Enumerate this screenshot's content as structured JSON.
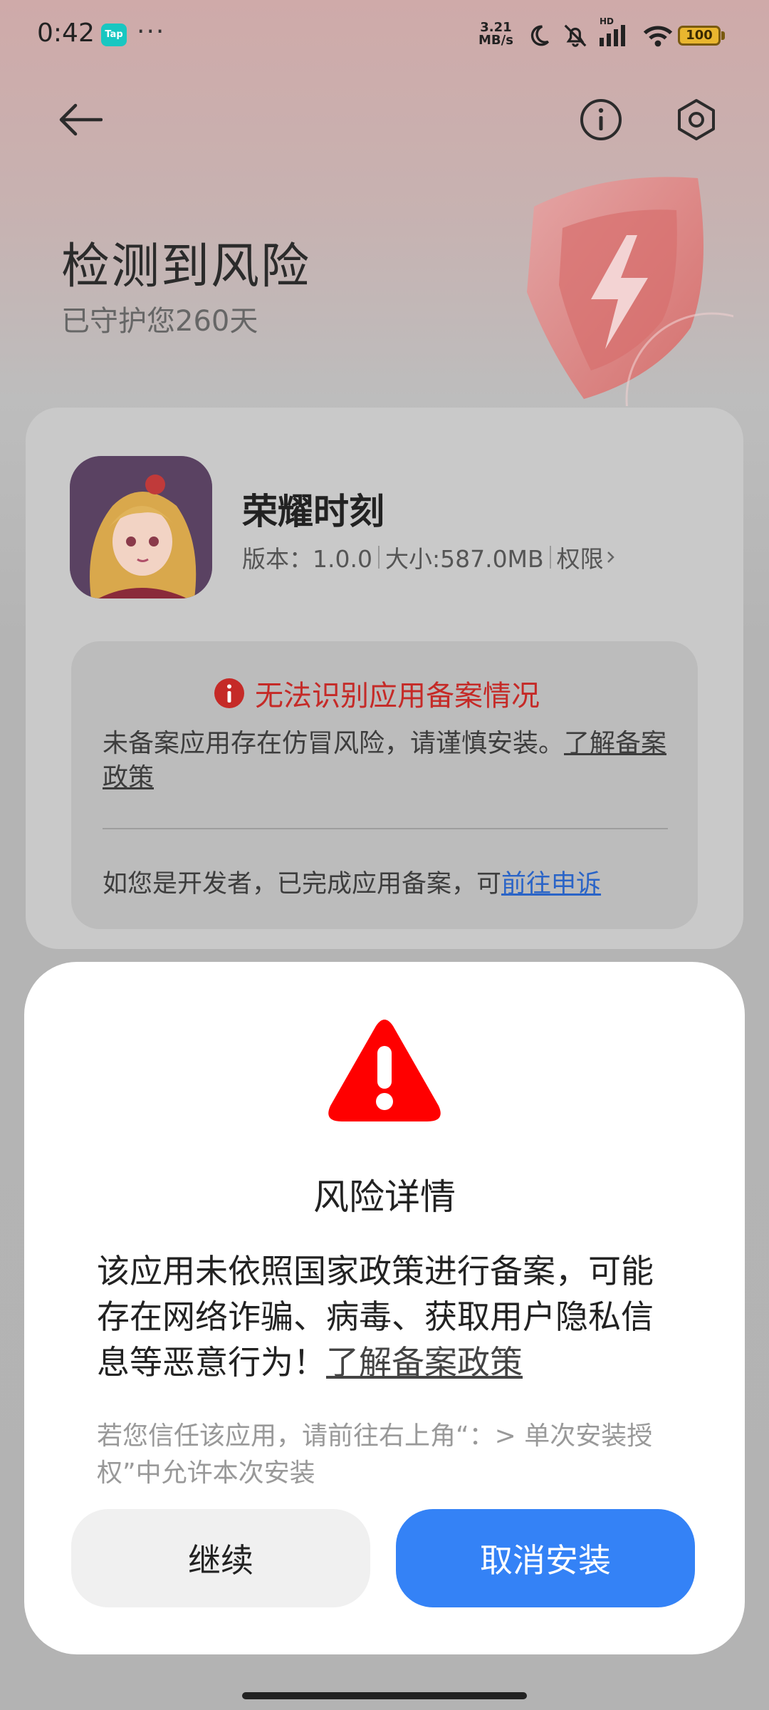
{
  "status_bar": {
    "time": "0:42",
    "tap_badge": "Tap",
    "more": "···",
    "net_speed_value": "3.21",
    "net_speed_unit": "MB/s",
    "hd": "HD",
    "battery": "100"
  },
  "header": {
    "title": "检测到风险",
    "subtitle": "已守护您260天"
  },
  "app": {
    "name": "荣耀时刻",
    "version": "版本：1.0.0",
    "size": "大小:587.0MB",
    "permissions": "权限"
  },
  "notice": {
    "title": "无法识别应用备案情况",
    "body_text": "未备案应用存在仿冒风险，请谨慎安装。",
    "body_link": "了解备案政策",
    "dev_text": "如您是开发者，已完成应用备案，可",
    "dev_link": "前往申诉"
  },
  "dialog": {
    "title": "风险详情",
    "body_text": "该应用未依照国家政策进行备案，可能存在网络诈骗、病毒、获取用户隐私信息等恶意行为！",
    "body_link": "了解备案政策",
    "hint": "若您信任该应用，请前往右上角“：> 单次安装授权”中允许本次安装",
    "continue_label": "继续",
    "cancel_label": "取消安装"
  },
  "colors": {
    "accent_blue": "#3482f6",
    "warning_red": "#ff0000",
    "notice_red": "#c52a27",
    "link_blue": "#2a64c7"
  },
  "icons": [
    "back-arrow-icon",
    "info-icon",
    "settings-icon",
    "shield-bolt-icon",
    "alert-circle-icon",
    "warning-triangle-icon",
    "chevron-right-icon"
  ]
}
